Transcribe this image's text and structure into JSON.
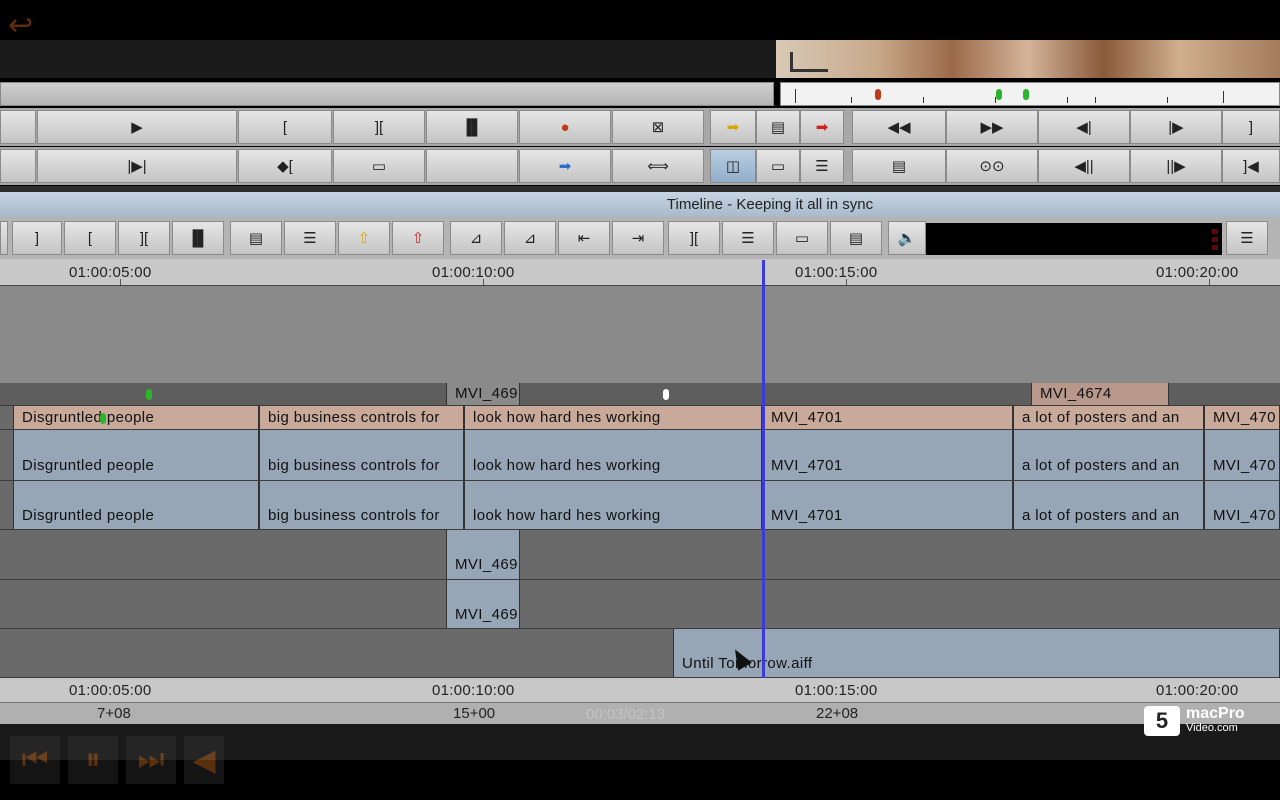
{
  "timeline": {
    "title": "Timeline - Keeping it all in sync",
    "ruler_labels": [
      "01:00:05:00",
      "01:00:10:00",
      "01:00:15:00",
      "01:00:20:00"
    ],
    "counter_labels": [
      "7+08",
      "15+00",
      "22+08"
    ],
    "player_time": "00:03/02:13"
  },
  "tracks": {
    "track_v_head": [
      {
        "label": "MVI_469"
      },
      {
        "label": "MVI_4674"
      }
    ],
    "track_salmon": [
      {
        "label": "Disgruntled people"
      },
      {
        "label": "big business controls for"
      },
      {
        "label": "look how hard hes working"
      },
      {
        "label": "MVI_4701"
      },
      {
        "label": "a lot of posters and an"
      },
      {
        "label": "MVI_470"
      }
    ],
    "track_a1": [
      {
        "label": "Disgruntled people"
      },
      {
        "label": "big business controls for"
      },
      {
        "label": "look how hard hes working"
      },
      {
        "label": "MVI_4701"
      },
      {
        "label": "a lot of posters and an"
      },
      {
        "label": "MVI_470"
      }
    ],
    "track_a2": [
      {
        "label": "Disgruntled people"
      },
      {
        "label": "big business controls for"
      },
      {
        "label": "look how hard hes working"
      },
      {
        "label": "MVI_4701"
      },
      {
        "label": "a lot of posters and an"
      },
      {
        "label": "MVI_470"
      }
    ],
    "track_a3": [
      {
        "label": "MVI_469"
      }
    ],
    "track_a4": [
      {
        "label": "MVI_469"
      }
    ],
    "track_music": [
      {
        "label": "Until Tomorrow.aiff"
      }
    ]
  },
  "logo": {
    "brand": "macPro",
    "sub": "Video.com"
  },
  "icons": {
    "back": "back-arrow-icon",
    "play": "play-icon",
    "pause": "pause-icon",
    "speaker": "speaker-icon",
    "menu": "menu-icon"
  },
  "colors": {
    "playhead": "#3b3bd8",
    "clip_blue": "#97a6b6",
    "clip_salmon": "#c9a99a",
    "marker_red": "#c0391b",
    "marker_green": "#2bb52b"
  }
}
